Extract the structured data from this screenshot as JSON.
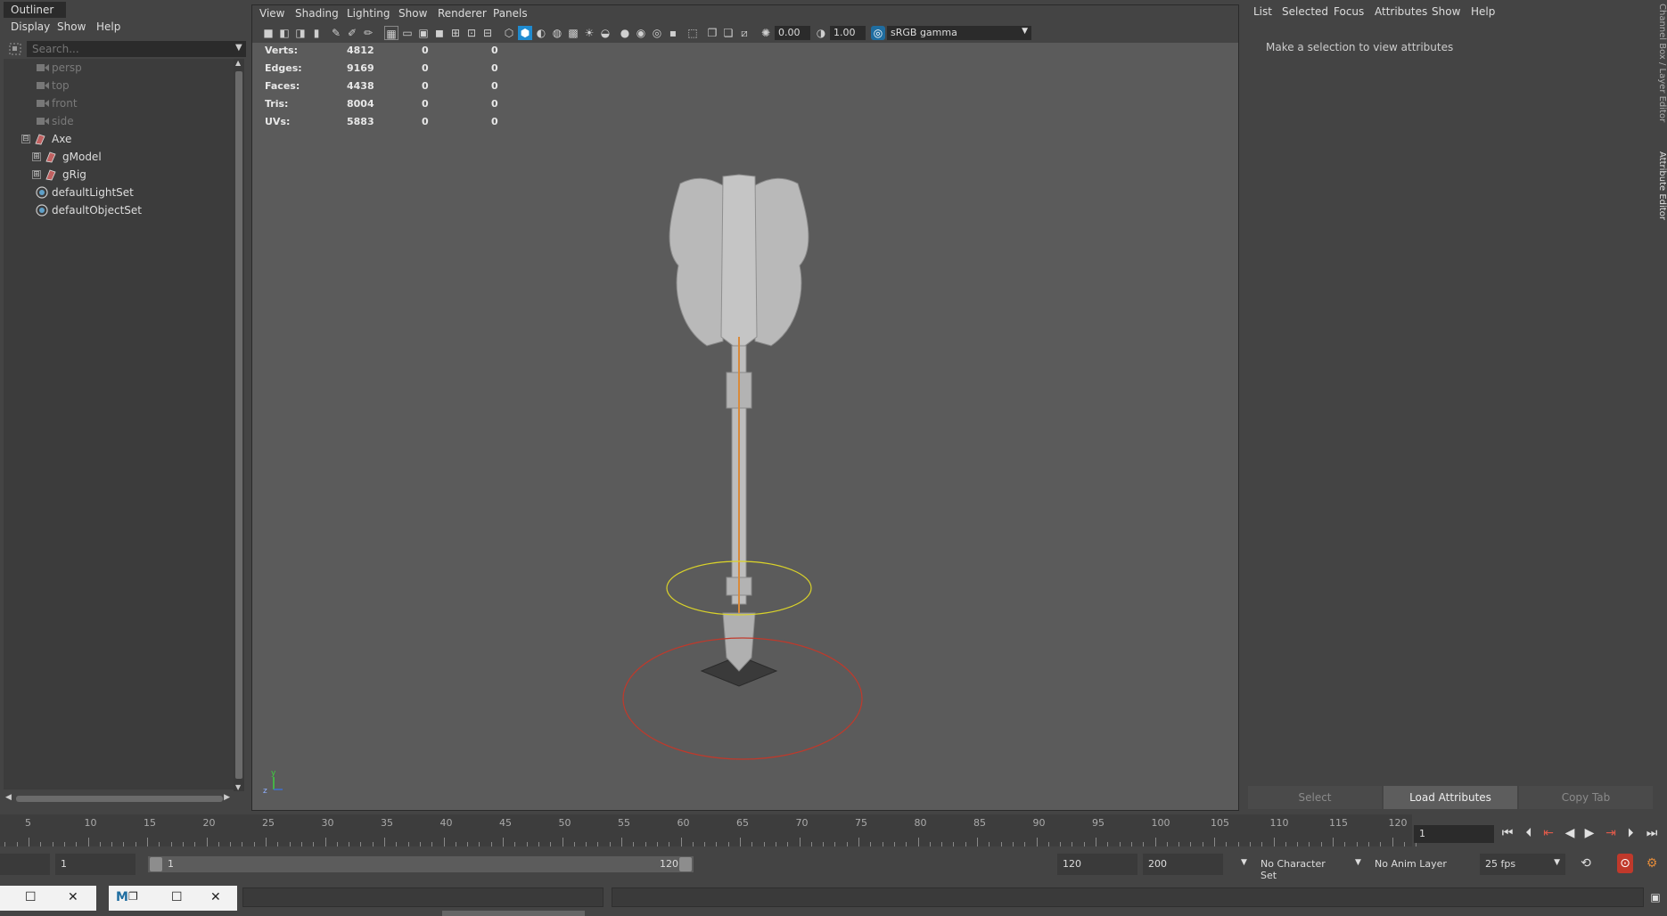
{
  "outliner": {
    "title": "Outliner",
    "menu": [
      "Display",
      "Show",
      "Help"
    ],
    "search_placeholder": "Search...",
    "items": [
      {
        "label": "persp"
      },
      {
        "label": "top"
      },
      {
        "label": "front"
      },
      {
        "label": "side"
      },
      {
        "label": "Axe"
      },
      {
        "label": "gModel"
      },
      {
        "label": "gRig"
      },
      {
        "label": "defaultLightSet"
      },
      {
        "label": "defaultObjectSet"
      }
    ],
    "expander_glyphs": [
      "⊟",
      "⊞",
      "⊞"
    ]
  },
  "viewport": {
    "menu": [
      "View",
      "Shading",
      "Lighting",
      "Show",
      "Renderer",
      "Panels"
    ],
    "toolbar": {
      "exposure": "0.00",
      "gamma": "1.00",
      "color_space": "sRGB gamma"
    },
    "hud": [
      {
        "label": "Verts:",
        "v1": "4812",
        "v2": "0",
        "v3": "0"
      },
      {
        "label": "Edges:",
        "v1": "9169",
        "v2": "0",
        "v3": "0"
      },
      {
        "label": "Faces:",
        "v1": "4438",
        "v2": "0",
        "v3": "0"
      },
      {
        "label": "Tris:",
        "v1": "8004",
        "v2": "0",
        "v3": "0"
      },
      {
        "label": "UVs:",
        "v1": "5883",
        "v2": "0",
        "v3": "0"
      }
    ],
    "axis": {
      "y": "y",
      "z": "z"
    }
  },
  "attribute_editor": {
    "menu": [
      "List",
      "Selected",
      "Focus",
      "Attributes",
      "Show",
      "Help"
    ],
    "message": "Make a selection to view attributes",
    "buttons": {
      "select": "Select",
      "load": "Load Attributes",
      "copy": "Copy Tab"
    },
    "side_tabs": {
      "channel_box": "Channel Box / Layer Editor",
      "attribute_editor": "Attribute Editor"
    }
  },
  "timeline": {
    "ticks": [
      "5",
      "10",
      "15",
      "20",
      "25",
      "30",
      "35",
      "40",
      "45",
      "50",
      "55",
      "60",
      "65",
      "70",
      "75",
      "80",
      "85",
      "90",
      "95",
      "100",
      "105",
      "110",
      "115",
      "120"
    ],
    "current_frame": "1"
  },
  "range": {
    "start_field": "1",
    "range_start": "1",
    "range_end": "120",
    "end_field": "120",
    "max_field": "200",
    "character_set": "No Character Set",
    "anim_layer": "No Anim Layer",
    "fps": "25 fps"
  },
  "colors": {
    "selection_ring": "#d9d22a",
    "root_ring": "#c0392b",
    "axe_spine": "#d98a3a",
    "active_tool": "#1f8bd0"
  }
}
